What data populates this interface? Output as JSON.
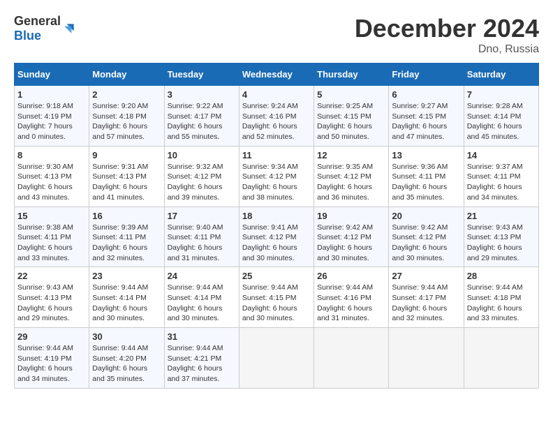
{
  "logo": {
    "text_general": "General",
    "text_blue": "Blue"
  },
  "calendar": {
    "title": "December 2024",
    "subtitle": "Dno, Russia"
  },
  "weekdays": [
    "Sunday",
    "Monday",
    "Tuesday",
    "Wednesday",
    "Thursday",
    "Friday",
    "Saturday"
  ],
  "weeks": [
    [
      {
        "day": "1",
        "info": "Sunrise: 9:18 AM\nSunset: 4:19 PM\nDaylight: 7 hours\nand 0 minutes."
      },
      {
        "day": "2",
        "info": "Sunrise: 9:20 AM\nSunset: 4:18 PM\nDaylight: 6 hours\nand 57 minutes."
      },
      {
        "day": "3",
        "info": "Sunrise: 9:22 AM\nSunset: 4:17 PM\nDaylight: 6 hours\nand 55 minutes."
      },
      {
        "day": "4",
        "info": "Sunrise: 9:24 AM\nSunset: 4:16 PM\nDaylight: 6 hours\nand 52 minutes."
      },
      {
        "day": "5",
        "info": "Sunrise: 9:25 AM\nSunset: 4:15 PM\nDaylight: 6 hours\nand 50 minutes."
      },
      {
        "day": "6",
        "info": "Sunrise: 9:27 AM\nSunset: 4:15 PM\nDaylight: 6 hours\nand 47 minutes."
      },
      {
        "day": "7",
        "info": "Sunrise: 9:28 AM\nSunset: 4:14 PM\nDaylight: 6 hours\nand 45 minutes."
      }
    ],
    [
      {
        "day": "8",
        "info": "Sunrise: 9:30 AM\nSunset: 4:13 PM\nDaylight: 6 hours\nand 43 minutes."
      },
      {
        "day": "9",
        "info": "Sunrise: 9:31 AM\nSunset: 4:13 PM\nDaylight: 6 hours\nand 41 minutes."
      },
      {
        "day": "10",
        "info": "Sunrise: 9:32 AM\nSunset: 4:12 PM\nDaylight: 6 hours\nand 39 minutes."
      },
      {
        "day": "11",
        "info": "Sunrise: 9:34 AM\nSunset: 4:12 PM\nDaylight: 6 hours\nand 38 minutes."
      },
      {
        "day": "12",
        "info": "Sunrise: 9:35 AM\nSunset: 4:12 PM\nDaylight: 6 hours\nand 36 minutes."
      },
      {
        "day": "13",
        "info": "Sunrise: 9:36 AM\nSunset: 4:11 PM\nDaylight: 6 hours\nand 35 minutes."
      },
      {
        "day": "14",
        "info": "Sunrise: 9:37 AM\nSunset: 4:11 PM\nDaylight: 6 hours\nand 34 minutes."
      }
    ],
    [
      {
        "day": "15",
        "info": "Sunrise: 9:38 AM\nSunset: 4:11 PM\nDaylight: 6 hours\nand 33 minutes."
      },
      {
        "day": "16",
        "info": "Sunrise: 9:39 AM\nSunset: 4:11 PM\nDaylight: 6 hours\nand 32 minutes."
      },
      {
        "day": "17",
        "info": "Sunrise: 9:40 AM\nSunset: 4:11 PM\nDaylight: 6 hours\nand 31 minutes."
      },
      {
        "day": "18",
        "info": "Sunrise: 9:41 AM\nSunset: 4:12 PM\nDaylight: 6 hours\nand 30 minutes."
      },
      {
        "day": "19",
        "info": "Sunrise: 9:42 AM\nSunset: 4:12 PM\nDaylight: 6 hours\nand 30 minutes."
      },
      {
        "day": "20",
        "info": "Sunrise: 9:42 AM\nSunset: 4:12 PM\nDaylight: 6 hours\nand 30 minutes."
      },
      {
        "day": "21",
        "info": "Sunrise: 9:43 AM\nSunset: 4:13 PM\nDaylight: 6 hours\nand 29 minutes."
      }
    ],
    [
      {
        "day": "22",
        "info": "Sunrise: 9:43 AM\nSunset: 4:13 PM\nDaylight: 6 hours\nand 29 minutes."
      },
      {
        "day": "23",
        "info": "Sunrise: 9:44 AM\nSunset: 4:14 PM\nDaylight: 6 hours\nand 30 minutes."
      },
      {
        "day": "24",
        "info": "Sunrise: 9:44 AM\nSunset: 4:14 PM\nDaylight: 6 hours\nand 30 minutes."
      },
      {
        "day": "25",
        "info": "Sunrise: 9:44 AM\nSunset: 4:15 PM\nDaylight: 6 hours\nand 30 minutes."
      },
      {
        "day": "26",
        "info": "Sunrise: 9:44 AM\nSunset: 4:16 PM\nDaylight: 6 hours\nand 31 minutes."
      },
      {
        "day": "27",
        "info": "Sunrise: 9:44 AM\nSunset: 4:17 PM\nDaylight: 6 hours\nand 32 minutes."
      },
      {
        "day": "28",
        "info": "Sunrise: 9:44 AM\nSunset: 4:18 PM\nDaylight: 6 hours\nand 33 minutes."
      }
    ],
    [
      {
        "day": "29",
        "info": "Sunrise: 9:44 AM\nSunset: 4:19 PM\nDaylight: 6 hours\nand 34 minutes."
      },
      {
        "day": "30",
        "info": "Sunrise: 9:44 AM\nSunset: 4:20 PM\nDaylight: 6 hours\nand 35 minutes."
      },
      {
        "day": "31",
        "info": "Sunrise: 9:44 AM\nSunset: 4:21 PM\nDaylight: 6 hours\nand 37 minutes."
      },
      {
        "day": "",
        "info": ""
      },
      {
        "day": "",
        "info": ""
      },
      {
        "day": "",
        "info": ""
      },
      {
        "day": "",
        "info": ""
      }
    ]
  ]
}
